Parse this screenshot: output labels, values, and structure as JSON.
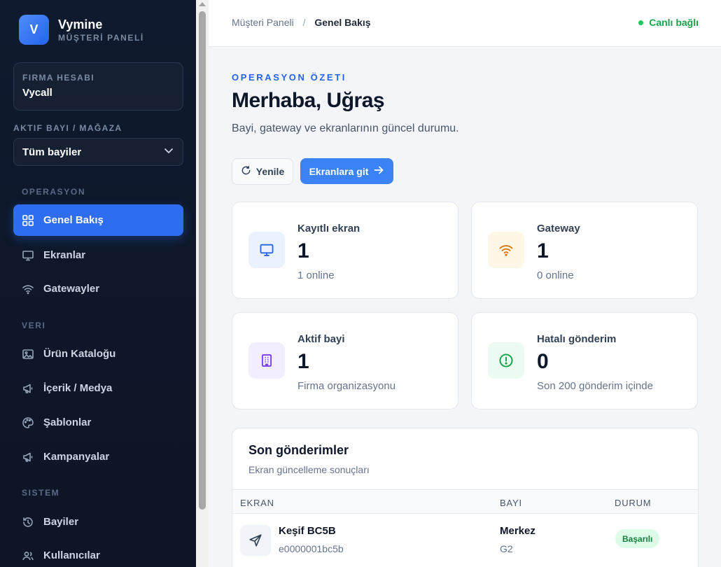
{
  "brand": {
    "logo_letter": "V",
    "name": "Vymine",
    "subtitle": "MÜŞTERİ PANELİ"
  },
  "company": {
    "label": "FIRMA HESABI",
    "value": "Vycall"
  },
  "dealer": {
    "label": "AKTIF BAYI / MAĞAZA",
    "selected": "Tüm bayiler"
  },
  "sidebar": {
    "sections": [
      "OPERASYON",
      "VERI",
      "SISTEM"
    ],
    "items": [
      {
        "label": "Genel Bakış",
        "icon": "grid-icon",
        "active": true
      },
      {
        "label": "Ekranlar",
        "icon": "monitor-icon"
      },
      {
        "label": "Gatewayler",
        "icon": "wifi-icon"
      },
      {
        "label": "Ürün Kataloğu",
        "icon": "image-icon"
      },
      {
        "label": "İçerik / Medya",
        "icon": "megaphone-icon"
      },
      {
        "label": "Şablonlar",
        "icon": "palette-icon"
      },
      {
        "label": "Kampanyalar",
        "icon": "megaphone-icon"
      },
      {
        "label": "Bayiler",
        "icon": "history-icon"
      },
      {
        "label": "Kullanıcılar",
        "icon": "users-icon"
      }
    ]
  },
  "header": {
    "breadcrumb_root": "Müşteri Paneli",
    "breadcrumb_sep": "/",
    "breadcrumb_current": "Genel Bakış",
    "status": "Canlı bağlı"
  },
  "hero": {
    "eyebrow": "OPERASYON ÖZETI",
    "greeting": "Merhaba, Uğraş",
    "subtitle": "Bayi, gateway ve ekranlarının güncel durumu."
  },
  "actions": {
    "refresh": "Yenile",
    "go_screens": "Ekranlara git"
  },
  "stats": [
    {
      "label": "Kayıtlı ekran",
      "value": "1",
      "sub": "1 online",
      "icon": "monitor-icon",
      "color": "#2563eb",
      "bg": "#eaf2ff"
    },
    {
      "label": "Gateway",
      "value": "1",
      "sub": "0 online",
      "icon": "wifi-icon",
      "color": "#d97706",
      "bg": "#fff7e6"
    },
    {
      "label": "Aktif bayi",
      "value": "1",
      "sub": "Firma organizasyonu",
      "icon": "building-icon",
      "color": "#7c3aed",
      "bg": "#f3eeff"
    },
    {
      "label": "Hatalı gönderim",
      "value": "0",
      "sub": "Son 200 gönderim içinde",
      "icon": "alert-circle-icon",
      "color": "#16a34a",
      "bg": "#ebfbf1"
    }
  ],
  "recent": {
    "title": "Son gönderimler",
    "subtitle": "Ekran güncelleme sonuçları",
    "columns": [
      "EKRAN",
      "BAYI",
      "DURUM"
    ],
    "rows": [
      {
        "screen": "Keşif BC5B",
        "screen_id": "e0000001bc5b",
        "dealer": "Merkez",
        "dealer_code": "G2",
        "status": "Başarılı"
      }
    ]
  }
}
